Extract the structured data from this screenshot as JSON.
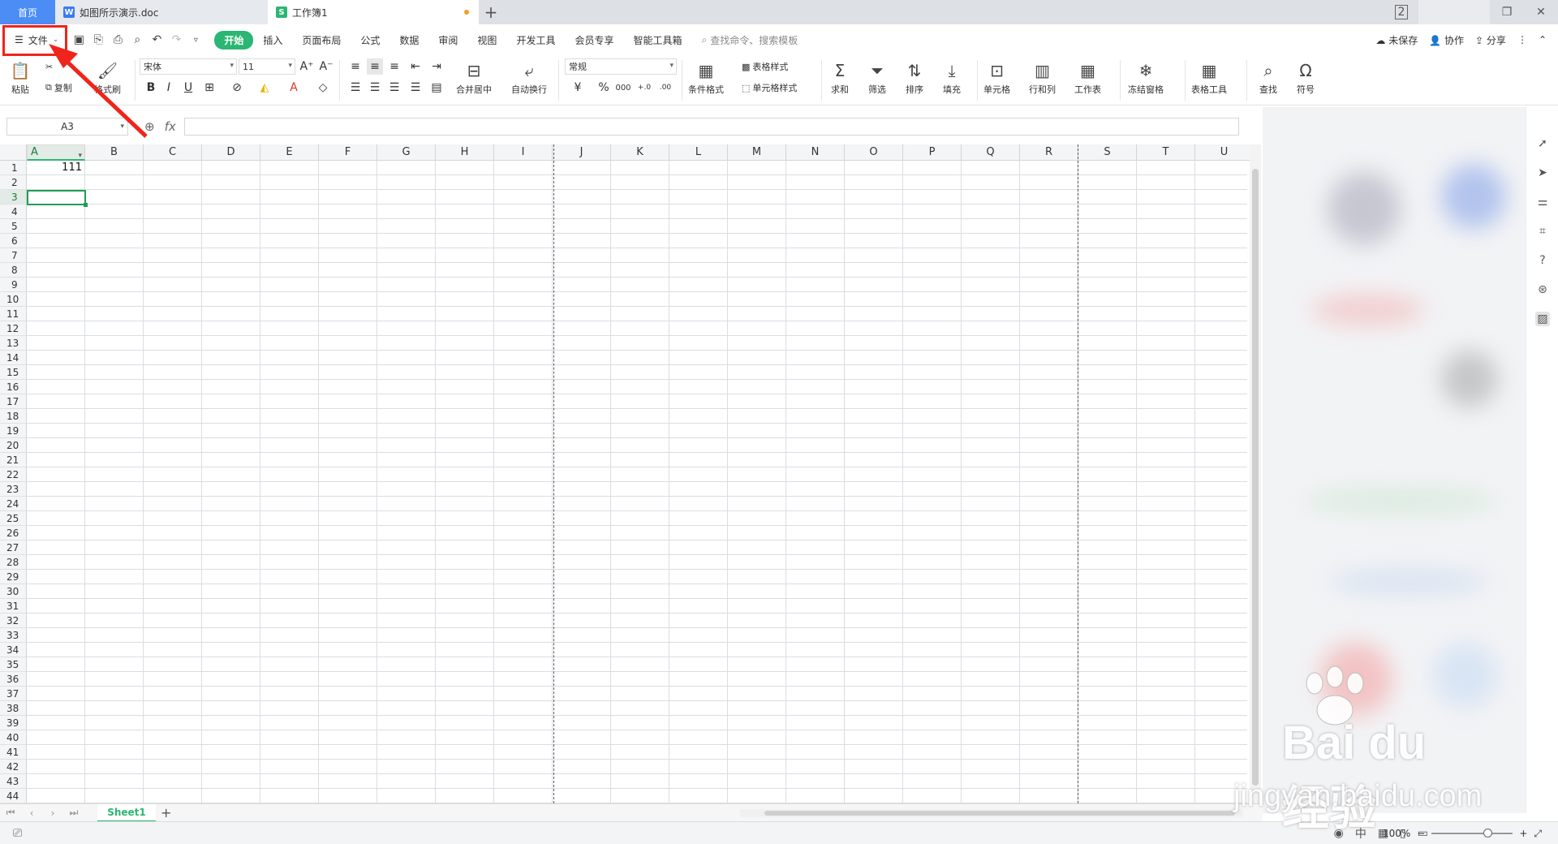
{
  "tabs": [
    {
      "label": "首页"
    },
    {
      "label": "如图所示演示.doc",
      "icon": "W"
    },
    {
      "label": "工作簿1",
      "icon": "S"
    }
  ],
  "window": {
    "badge": "2"
  },
  "menu": {
    "file_label": "文件",
    "tabs": [
      "开始",
      "插入",
      "页面布局",
      "公式",
      "数据",
      "审阅",
      "视图",
      "开发工具",
      "会员专享",
      "智能工具箱"
    ],
    "search_placeholder": "查找命令、搜索模板",
    "right": [
      "未保存",
      "协作",
      "分享"
    ]
  },
  "ribbon": {
    "paste": "粘贴",
    "cut": "剪切",
    "copy": "复制",
    "format_painter": "格式刷",
    "font_name": "宋体",
    "font_size": "11",
    "merge": "合并居中",
    "wrap": "自动换行",
    "number_format": "常规",
    "cond_format": "条件格式",
    "table_style": "表格样式",
    "cell_style": "单元格样式",
    "sum": "求和",
    "filter": "筛选",
    "sort": "排序",
    "fill": "填充",
    "cell": "单元格",
    "rowcol": "行和列",
    "sheet": "工作表",
    "freeze": "冻结窗格",
    "table_tools": "表格工具",
    "find": "查找",
    "symbol": "符号"
  },
  "formula_bar": {
    "cell_ref": "A3",
    "fx": "fx",
    "value": ""
  },
  "grid": {
    "columns": [
      "A",
      "B",
      "C",
      "D",
      "E",
      "F",
      "G",
      "H",
      "I",
      "J",
      "K",
      "L",
      "M",
      "N",
      "O",
      "P",
      "Q",
      "R",
      "S",
      "T",
      "U"
    ],
    "selected_column": "A",
    "selected_row": 3,
    "rows": 44,
    "cells": [
      {
        "ref": "A1",
        "value": "111"
      }
    ]
  },
  "sheets": [
    "Sheet1"
  ],
  "status": {
    "zoom": "100%"
  },
  "watermark": {
    "brand": "Bai  du经验",
    "url": "jingyan.baidu.com"
  },
  "colors": {
    "accent": "#2bb673",
    "highlight": "#f0241b",
    "home_tab": "#4c8cf5"
  }
}
